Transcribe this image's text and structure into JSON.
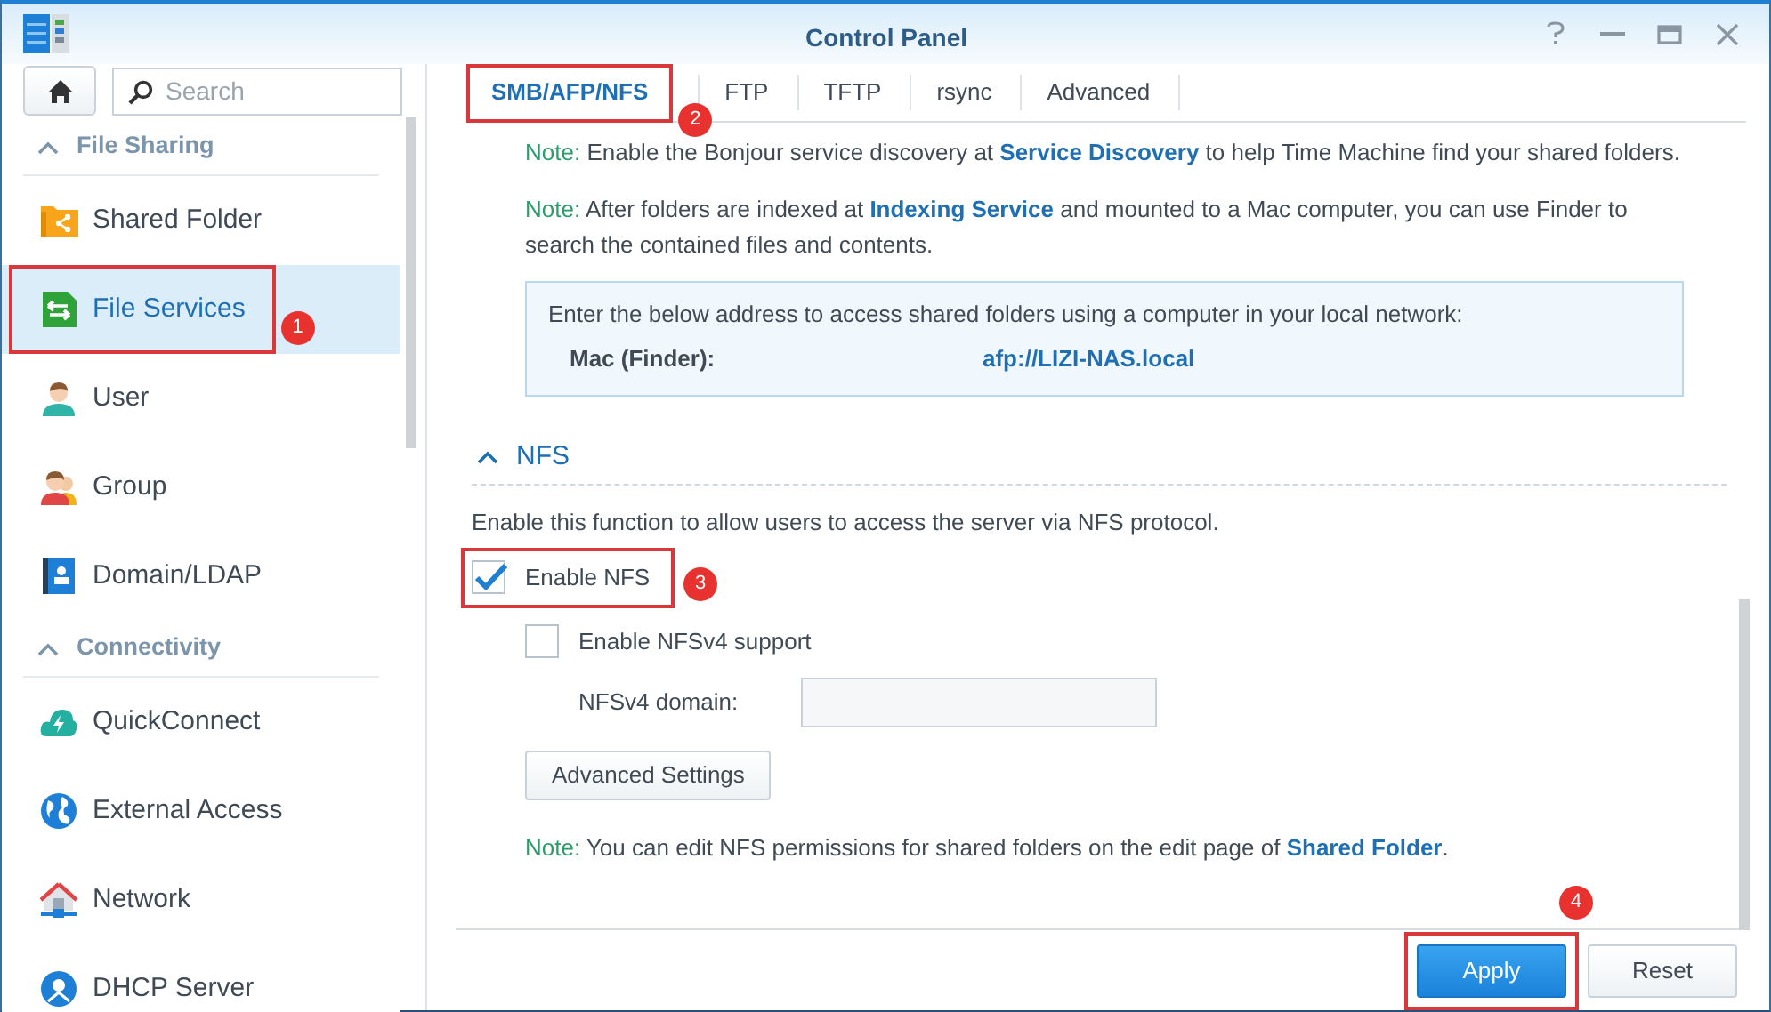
{
  "window": {
    "title": "Control Panel"
  },
  "sidebar": {
    "search": {
      "placeholder": "Search"
    },
    "sections": [
      {
        "title": "File Sharing",
        "expanded": true,
        "items": [
          {
            "label": "Shared Folder",
            "selected": false
          },
          {
            "label": "File Services",
            "selected": true,
            "annotation": "1"
          },
          {
            "label": "User",
            "selected": false
          },
          {
            "label": "Group",
            "selected": false
          },
          {
            "label": "Domain/LDAP",
            "selected": false
          }
        ]
      },
      {
        "title": "Connectivity",
        "expanded": true,
        "items": [
          {
            "label": "QuickConnect",
            "selected": false
          },
          {
            "label": "External Access",
            "selected": false
          },
          {
            "label": "Network",
            "selected": false
          },
          {
            "label": "DHCP Server",
            "selected": false
          }
        ]
      }
    ]
  },
  "tabs": [
    {
      "label": "SMB/AFP/NFS",
      "selected": true,
      "annotation": "2"
    },
    {
      "label": "FTP",
      "selected": false
    },
    {
      "label": "TFTP",
      "selected": false
    },
    {
      "label": "rsync",
      "selected": false
    },
    {
      "label": "Advanced",
      "selected": false
    }
  ],
  "afp": {
    "notes": [
      {
        "label": "Note:",
        "before": "Enable the Bonjour service discovery at",
        "link": "Service Discovery",
        "after": "to help Time Machine find your shared folders."
      },
      {
        "label": "Note:",
        "before": "After folders are indexed at",
        "link": "Indexing Service",
        "after": "and mounted to a Mac computer, you can use Finder to search the contained files and contents."
      }
    ],
    "address_box": {
      "intro": "Enter the below address to access shared folders using a computer in your local network:",
      "rows": [
        {
          "label": "Mac (Finder):",
          "value": "afp://LIZI-NAS.local"
        }
      ]
    }
  },
  "nfs": {
    "title": "NFS",
    "expanded": true,
    "description": "Enable this function to allow users to access the server via NFS protocol.",
    "options": [
      {
        "kind": "checkbox",
        "label": "Enable NFS",
        "checked": true,
        "annotation": "3"
      },
      {
        "kind": "checkbox",
        "label": "Enable NFSv4 support",
        "checked": false
      },
      {
        "kind": "field",
        "label": "NFSv4 domain:"
      },
      {
        "kind": "button",
        "label": "Advanced Settings"
      }
    ],
    "note": {
      "label": "Note:",
      "before": "You can edit NFS permissions for shared folders on the edit page of",
      "link": "Shared Folder",
      "after": "."
    }
  },
  "footer_buttons": [
    {
      "label": "Apply",
      "kind": "primary",
      "annotation": "4"
    },
    {
      "label": "Reset",
      "kind": "secondary"
    }
  ]
}
